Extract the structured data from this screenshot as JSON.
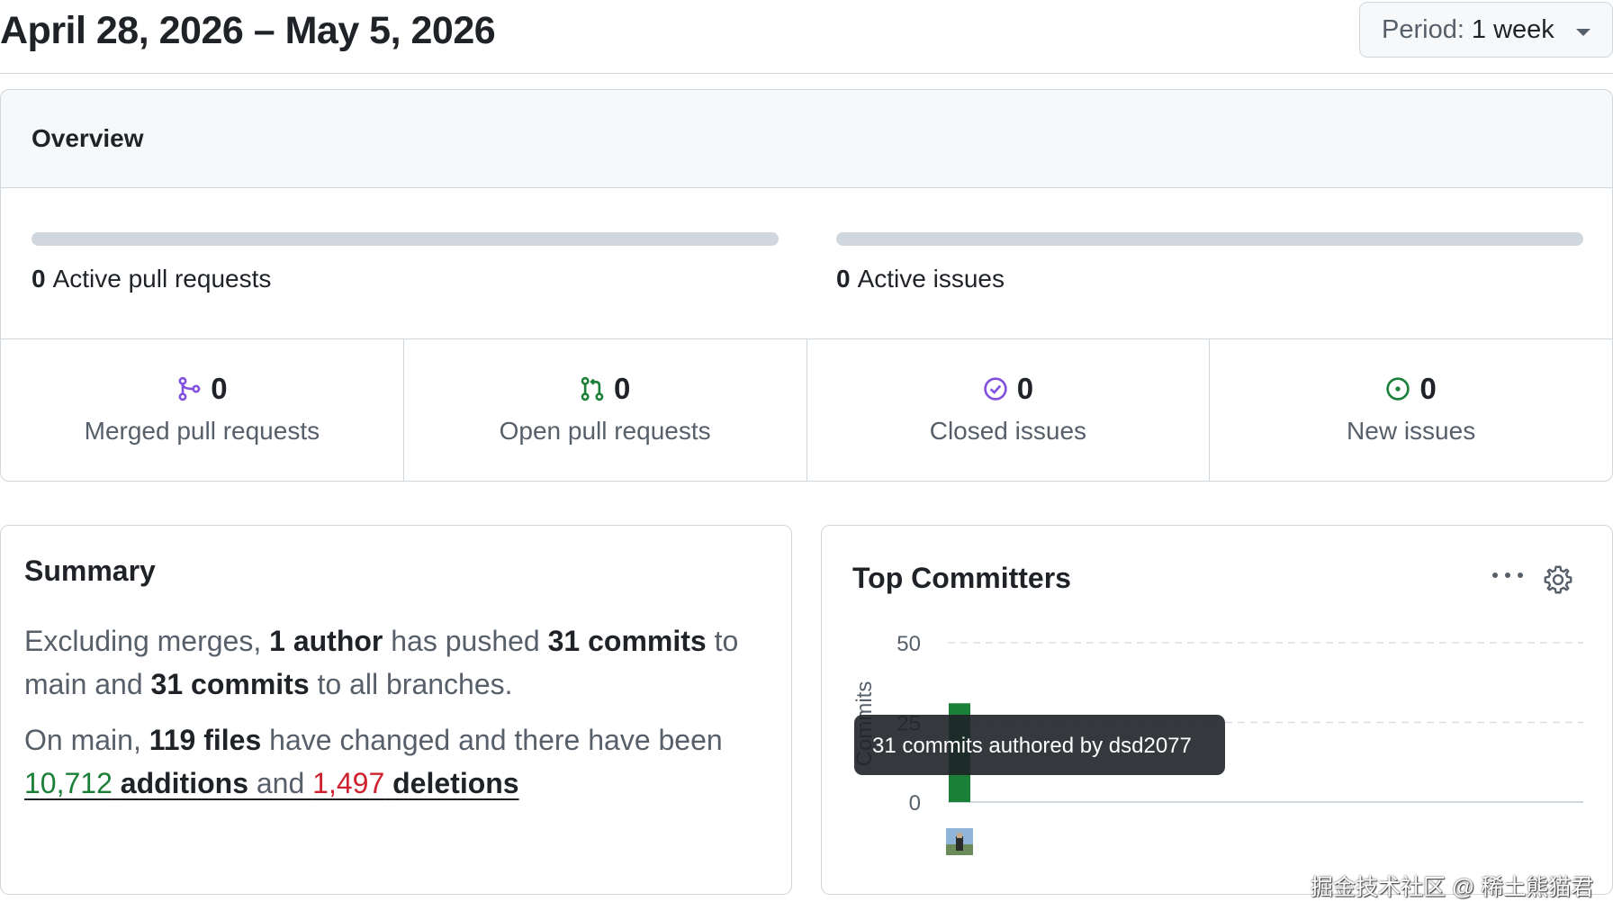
{
  "header": {
    "date_range": "April 28, 2026 – May 5, 2026",
    "period_prefix": "Period:",
    "period_value": "1 week"
  },
  "overview": {
    "title": "Overview",
    "active_prs": {
      "count": "0",
      "label": "Active pull requests",
      "merged_fraction": 0
    },
    "active_issues": {
      "count": "0",
      "label": "Active issues",
      "closed_fraction": 0
    },
    "stats": [
      {
        "icon": "git-merge-icon",
        "count": "0",
        "label": "Merged pull requests",
        "color": "#8250df"
      },
      {
        "icon": "git-pull-request-icon",
        "count": "0",
        "label": "Open pull requests",
        "color": "#1a7f37"
      },
      {
        "icon": "issue-closed-icon",
        "count": "0",
        "label": "Closed issues",
        "color": "#8250df"
      },
      {
        "icon": "issue-opened-icon",
        "count": "0",
        "label": "New issues",
        "color": "#1a7f37"
      }
    ]
  },
  "summary": {
    "title": "Summary",
    "p1": {
      "t1": "Excluding merges, ",
      "b1": "1 author",
      "t2": " has pushed ",
      "b2": "31 commits",
      "t3": " to main and ",
      "b3": "31 commits",
      "t4": " to all branches."
    },
    "p2": {
      "t1": "On main, ",
      "b1": "119 files",
      "t2": " have changed and there have been",
      "additions_num": "10,712",
      "additions_word": "additions",
      "and": " and ",
      "deletions_num": "1,497",
      "deletions_word": "deletions"
    }
  },
  "top_committers": {
    "title": "Top Committers",
    "tooltip": "31 commits authored by dsd2077"
  },
  "chart_data": {
    "type": "bar",
    "categories": [
      "dsd2077"
    ],
    "values": [
      31
    ],
    "ylabel": "Commits",
    "ylim": [
      0,
      50
    ],
    "yticks": [
      0,
      25,
      50
    ],
    "grid": true,
    "bar_color": "#1a7f37"
  },
  "watermark": "掘金技术社区 @ 稀土熊猫君",
  "colors": {
    "green": "#1a7f37",
    "red": "#cf222e",
    "purple": "#8250df",
    "border": "#d0d7de",
    "muted": "#57606a"
  }
}
